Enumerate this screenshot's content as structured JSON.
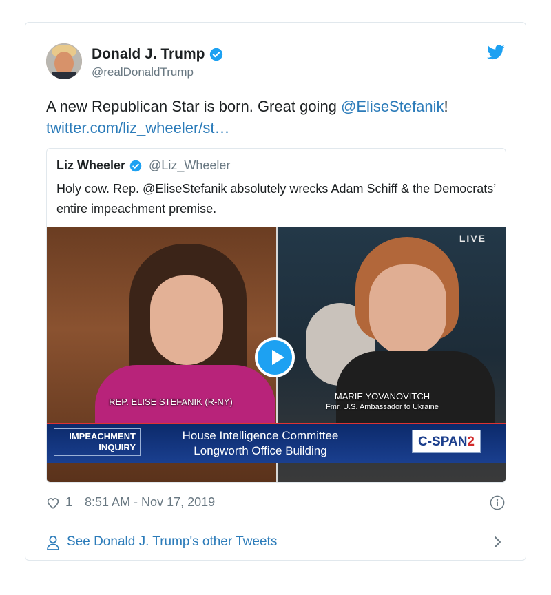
{
  "author": {
    "name": "Donald J. Trump",
    "handle": "@realDonaldTrump"
  },
  "tweet": {
    "text_before": "A new Republican Star is born. Great going ",
    "mention": "@EliseStefanik",
    "text_after": "!",
    "link": "twitter.com/liz_wheeler/st…"
  },
  "quoted": {
    "name": "Liz Wheeler",
    "handle": "@Liz_Wheeler",
    "text": "Holy cow. Rep. @EliseStefanik absolutely wrecks Adam Schiff & the Democrats’ entire impeachment premise."
  },
  "video": {
    "live": "LIVE",
    "left_caption": "REP. ELISE STEFANIK (R-NY)",
    "right_caption_name": "MARIE YOVANOVITCH",
    "right_caption_title": "Fmr. U.S. Ambassador to Ukraine",
    "box_line1": "IMPEACHMENT",
    "box_line2": "INQUIRY",
    "bar_line1": "House Intelligence Committee",
    "bar_line2": "Longworth Office Building",
    "network": "C-SPAN",
    "network_num": "2"
  },
  "meta": {
    "likes": "1",
    "timestamp": "8:51 AM - Nov 17, 2019"
  },
  "footer": {
    "label": "See Donald J. Trump's other Tweets"
  },
  "colors": {
    "link": "#2b7bb9",
    "verified": "#1da1f2",
    "muted": "#697882"
  }
}
